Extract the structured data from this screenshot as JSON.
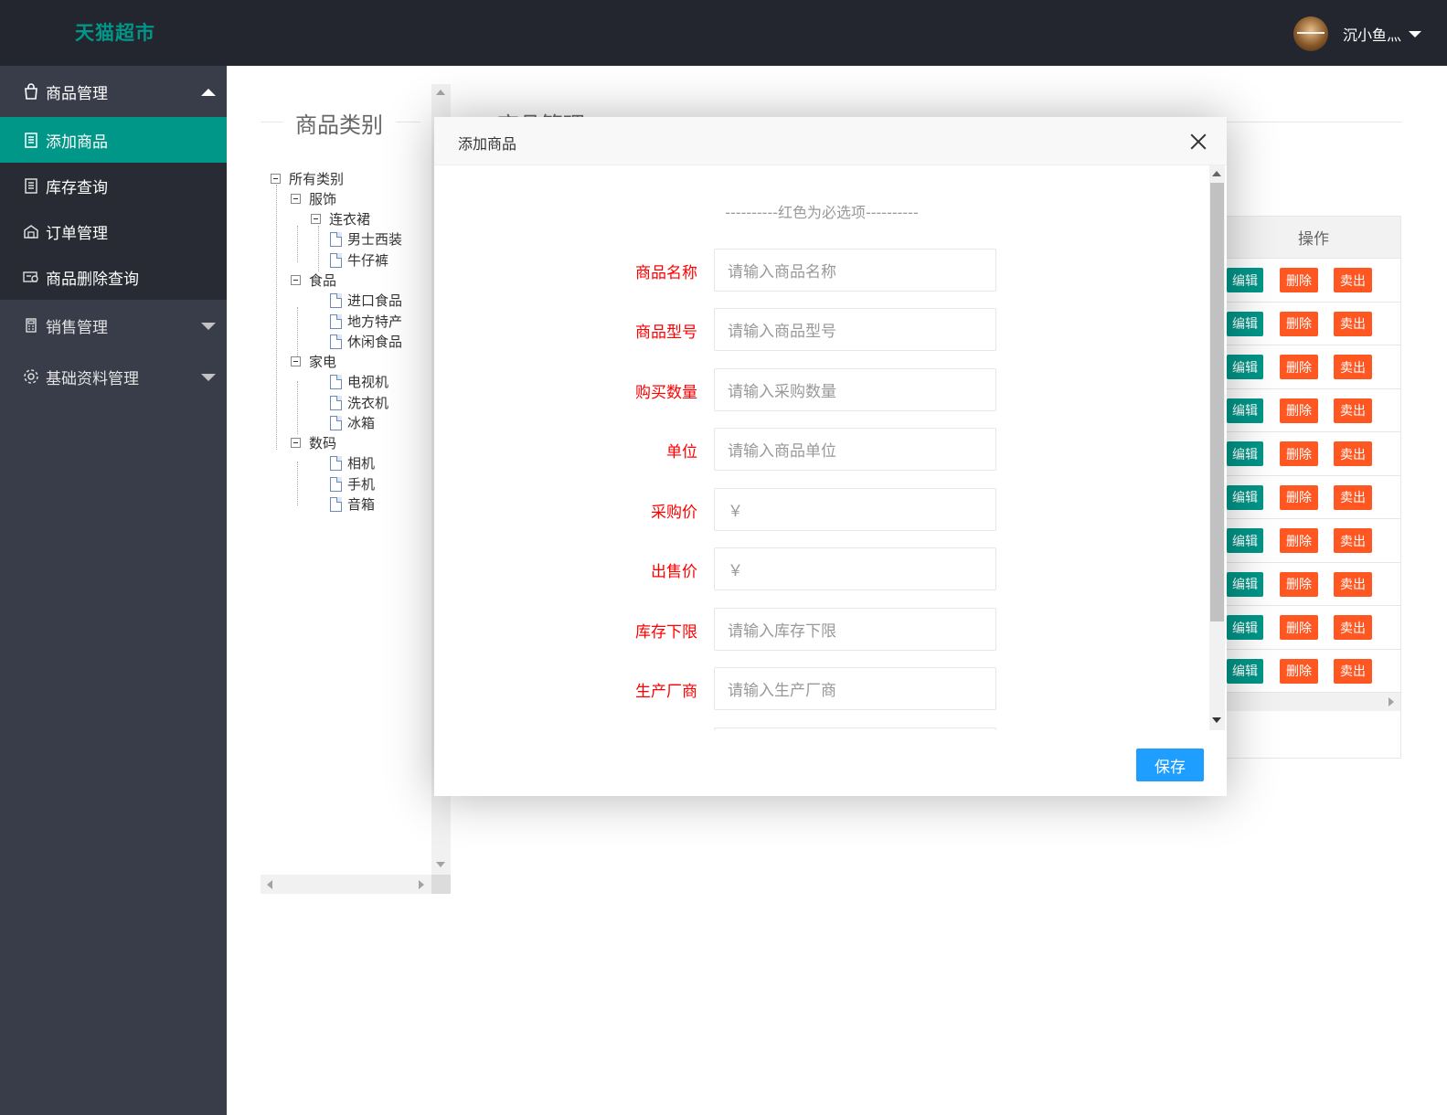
{
  "header": {
    "logo": "天猫超市",
    "username": "沉小鱼灬"
  },
  "sidebar": {
    "groups": [
      {
        "label": "商品管理",
        "icon": "shopping-bag-icon",
        "expanded": true,
        "items": [
          {
            "label": "添加商品",
            "icon": "document-icon",
            "active": true
          },
          {
            "label": "库存查询",
            "icon": "clipboard-icon",
            "active": false
          },
          {
            "label": "订单管理",
            "icon": "warehouse-icon",
            "active": false
          },
          {
            "label": "商品删除查询",
            "icon": "card-search-icon",
            "active": false
          }
        ]
      },
      {
        "label": "销售管理",
        "icon": "calculator-icon",
        "expanded": false
      },
      {
        "label": "基础资料管理",
        "icon": "gear-icon",
        "expanded": false
      }
    ]
  },
  "category_panel": {
    "title": "商品类别",
    "tree": {
      "root": "所有类别",
      "clothing": "服饰",
      "dress": "连衣裙",
      "suit": "男士西装",
      "jeans": "牛仔裤",
      "food": "食品",
      "imported": "进口食品",
      "local": "地方特产",
      "snack": "休闲食品",
      "appliance": "家电",
      "tv": "电视机",
      "washer": "洗衣机",
      "fridge": "冰箱",
      "digital": "数码",
      "camera": "相机",
      "phone": "手机",
      "audio": "音箱"
    }
  },
  "product_panel": {
    "title": "商品管理",
    "table": {
      "action_header": "操作",
      "row_buttons": {
        "edit": "编辑",
        "delete": "删除",
        "sell": "卖出"
      },
      "row_count": 10
    }
  },
  "modal": {
    "title": "添加商品",
    "note": "----------红色为必选项----------",
    "fields": [
      {
        "label": "商品名称",
        "placeholder": "请输入商品名称"
      },
      {
        "label": "商品型号",
        "placeholder": "请输入商品型号"
      },
      {
        "label": "购买数量",
        "placeholder": "请输入采购数量"
      },
      {
        "label": "单位",
        "placeholder": "请输入商品单位"
      },
      {
        "label": "采购价",
        "placeholder": "￥"
      },
      {
        "label": "出售价",
        "placeholder": "￥"
      },
      {
        "label": "库存下限",
        "placeholder": "请输入库存下限"
      },
      {
        "label": "生产厂商",
        "placeholder": "请输入生产厂商"
      }
    ],
    "save_label": "保存"
  },
  "colors": {
    "header_bg": "#23262e",
    "sidebar_bg": "#393d49",
    "active_bg": "#009688",
    "danger": "#ff5722",
    "primary": "#1e9fff",
    "required_label": "#ff0000"
  }
}
